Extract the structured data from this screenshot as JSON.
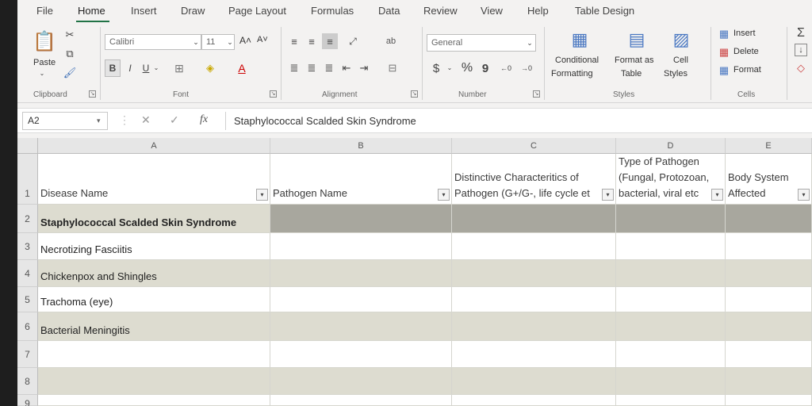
{
  "menu": {
    "tabs": [
      "File",
      "Home",
      "Insert",
      "Draw",
      "Page Layout",
      "Formulas",
      "Data",
      "Review",
      "View",
      "Help",
      "Table Design"
    ],
    "active": "Home"
  },
  "ribbon": {
    "clipboard": {
      "paste_label": "Paste",
      "group_label": "Clipboard"
    },
    "font": {
      "font_name": "Calibri",
      "font_size": "11",
      "bold": "B",
      "italic": "I",
      "underline": "U",
      "font_color_glyph": "A",
      "grow": "A˄",
      "shrink": "A˅",
      "group_label": "Font"
    },
    "alignment": {
      "group_label": "Alignment"
    },
    "number": {
      "format": "General",
      "currency": "$",
      "percent": "%",
      "comma": "9",
      "group_label": "Number"
    },
    "styles": {
      "conditional": "Conditional",
      "formatting": "Formatting",
      "format_as": "Format as",
      "table": "Table",
      "cell": "Cell",
      "styles": "Styles",
      "group_label": "Styles"
    },
    "cells": {
      "insert": "Insert",
      "delete": "Delete",
      "format": "Format",
      "group_label": "Cells"
    },
    "editing": {
      "sum": "Σ"
    }
  },
  "formula_bar": {
    "name_box": "A2",
    "fx": "fx",
    "content": "Staphylococcal Scalded Skin Syndrome"
  },
  "columns": [
    "A",
    "B",
    "C",
    "D",
    "E"
  ],
  "header_row": {
    "row_num": "1",
    "a": [
      "Disease Name"
    ],
    "b": [
      "Pathogen Name"
    ],
    "c": [
      "Distinctive Characteritics of",
      "Pathogen (G+/G-, life cycle et"
    ],
    "d": [
      "Type of Pathogen",
      "(Fungal, Protozoan,",
      "bacterial, viral etc"
    ],
    "e": [
      "Body System",
      "Affected"
    ]
  },
  "rows": [
    {
      "num": "2",
      "a": "Staphylococcal Scalded Skin Syndrome"
    },
    {
      "num": "3",
      "a": "Necrotizing Fasciitis"
    },
    {
      "num": "4",
      "a": "Chickenpox and Shingles"
    },
    {
      "num": "5",
      "a": "Trachoma (eye)"
    },
    {
      "num": "6",
      "a": "Bacterial Meningitis"
    },
    {
      "num": "7",
      "a": ""
    },
    {
      "num": "8",
      "a": ""
    },
    {
      "num": "9",
      "a": ""
    }
  ],
  "colors": {
    "accent": "#217346",
    "band": "#dddcd0",
    "selected": "#a8a79e"
  }
}
